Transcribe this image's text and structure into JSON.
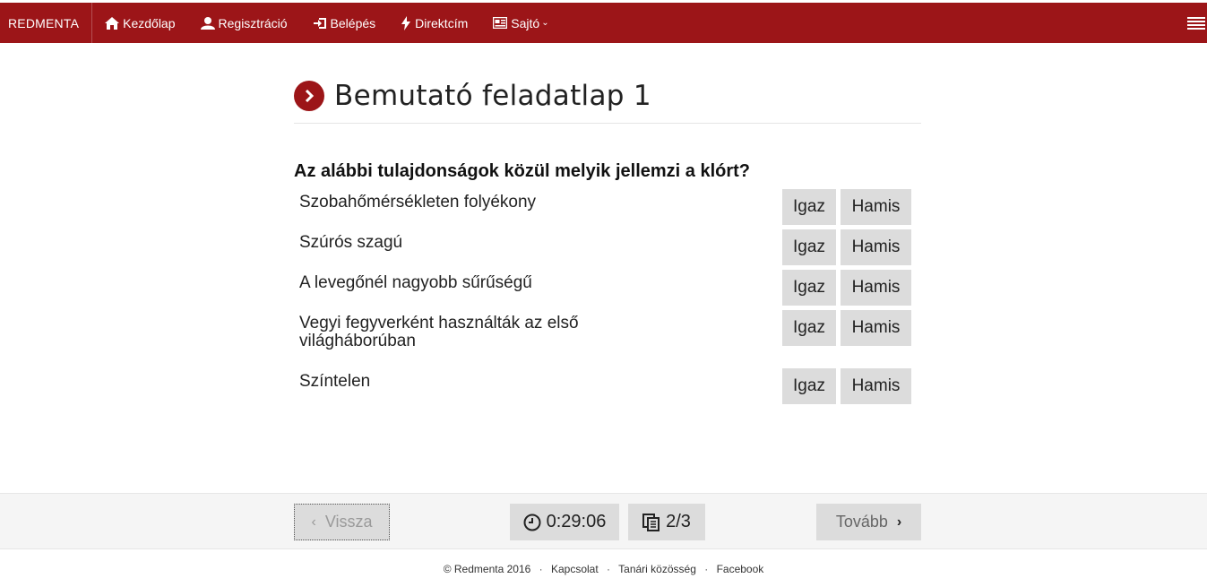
{
  "navbar": {
    "brand": "REDMENTA",
    "items": [
      {
        "label": "Kezdőlap",
        "icon": "home-icon"
      },
      {
        "label": "Regisztráció",
        "icon": "user-icon"
      },
      {
        "label": "Belépés",
        "icon": "login-icon"
      },
      {
        "label": "Direktcím",
        "icon": "bolt-icon"
      },
      {
        "label": "Sajtó",
        "icon": "newspaper-icon"
      }
    ],
    "caret": "⌄",
    "accent_color": "#9c1518"
  },
  "page": {
    "title": "Bemutató feladatlap 1"
  },
  "quiz": {
    "question": "Az alábbi tulajdonságok közül melyik jellemzi a klórt?",
    "true_label": "Igaz",
    "false_label": "Hamis",
    "statements": [
      "Szobahőmérsékleten folyékony",
      "Szúrós szagú",
      "A levegőnél nagyobb sűrűségű",
      "Vegyi fegyverként használták az első világháborúban",
      "Színtelen"
    ]
  },
  "pager": {
    "back_label": "Vissza",
    "timer": "0:29:06",
    "page_indicator": "2/3",
    "next_label": "Tovább"
  },
  "footer": {
    "copyright": "© Redmenta 2016",
    "links": [
      "Kapcsolat",
      "Tanári közösség",
      "Facebook"
    ],
    "separator": "·"
  }
}
